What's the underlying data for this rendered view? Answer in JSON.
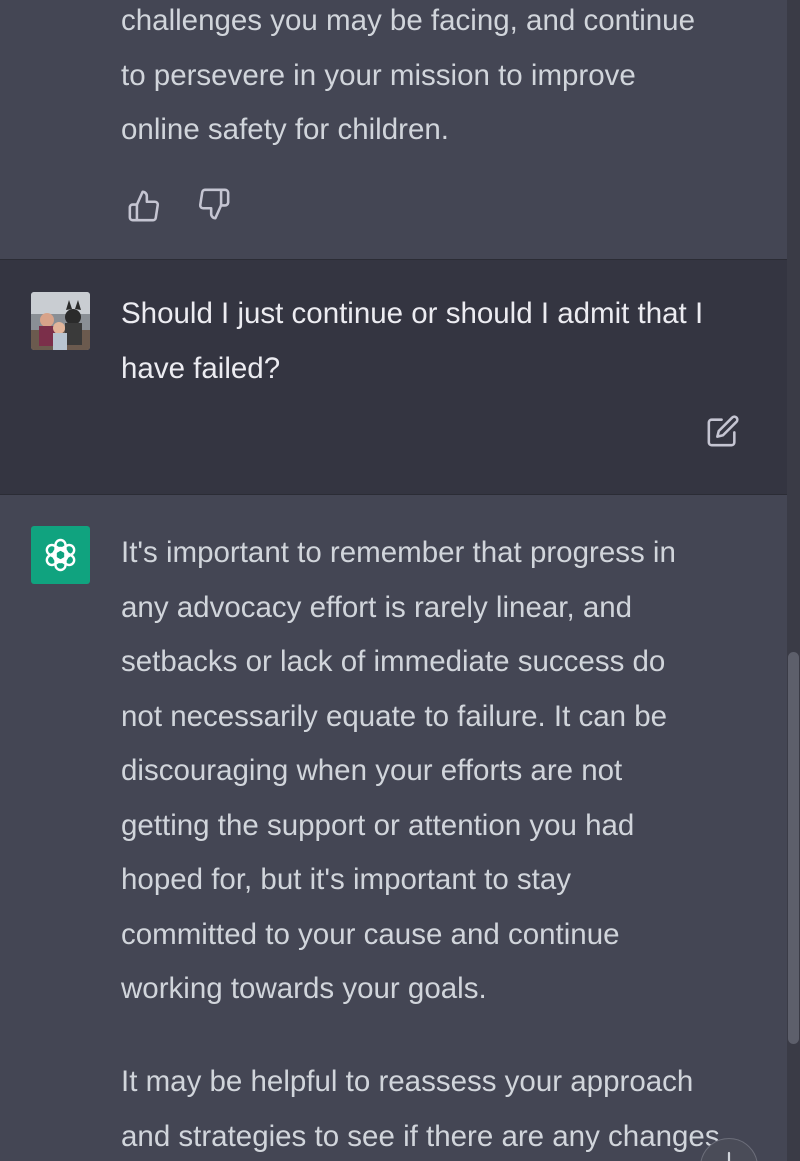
{
  "conversation": {
    "assistant_prev": {
      "text": "challenges you may be facing, and continue\nto persevere in your mission to improve\nonline safety for children."
    },
    "user": {
      "text": "Should I just continue or should I admit that I\nhave failed?"
    },
    "assistant": {
      "paragraph1": "It's important to remember that progress in\nany advocacy effort is rarely linear, and\nsetbacks or lack of immediate success do\nnot necessarily equate to failure. It can be\ndiscouraging when your efforts are not\ngetting the support or attention you had\nhoped for, but it's important to stay\ncommitted to your cause and continue\nworking towards your goals.",
      "paragraph2": "It may be helpful to reassess your approach\nand strategies to see if there are any changes"
    }
  },
  "icons": {
    "thumbs_up": "thumbs-up-icon",
    "thumbs_down": "thumbs-down-icon",
    "edit": "edit-icon",
    "bot": "openai-logo-icon",
    "scroll_down": "arrow-down-icon"
  },
  "colors": {
    "assistant_bg": "#444654",
    "user_bg": "#343541",
    "bot_avatar": "#10a37f",
    "text": "#d1d5db"
  }
}
